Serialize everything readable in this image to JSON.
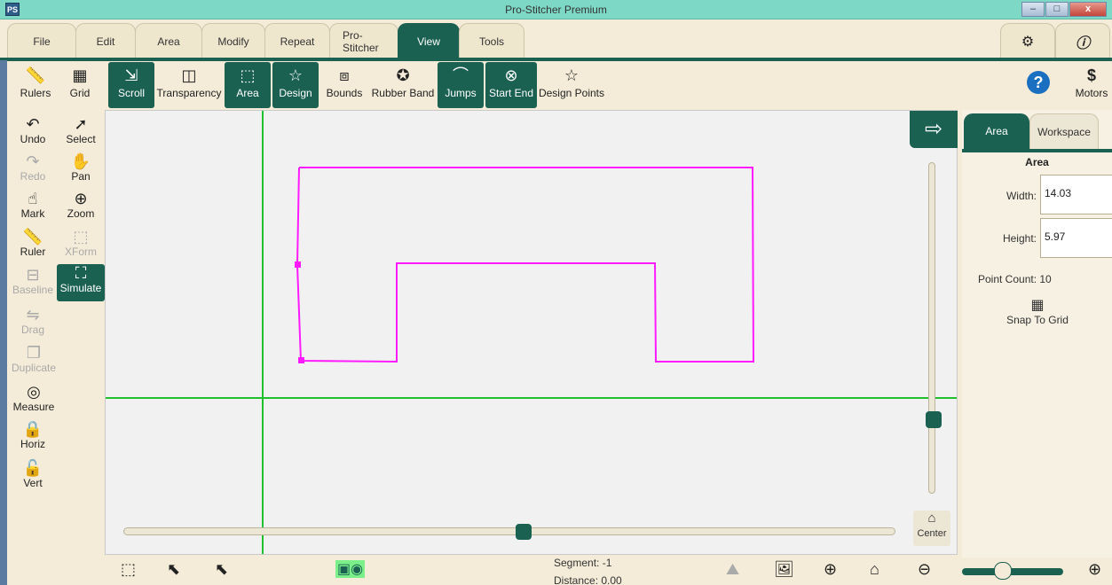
{
  "window": {
    "title": "Pro-Stitcher Premium",
    "app_icon": "PS",
    "controls": [
      "–",
      "□",
      "x"
    ]
  },
  "menu": {
    "tabs": [
      "File",
      "Edit",
      "Area",
      "Modify",
      "Repeat",
      "Pro-Stitcher",
      "View",
      "Tools"
    ],
    "active": "View",
    "right_icons": [
      "settings-gear-icon",
      "info-icon"
    ]
  },
  "toolbar": {
    "rulers": "Rulers",
    "grid": "Grid",
    "scroll": "Scroll",
    "transparency": "Transparency",
    "area": "Area",
    "design": "Design",
    "bounds": "Bounds",
    "rubber_band": "Rubber Band",
    "jumps": "Jumps",
    "start_end": "Start End",
    "design_points": "Design Points",
    "motors": "Motors"
  },
  "left_tools": {
    "undo": "Undo",
    "select": "Select",
    "redo": "Redo",
    "pan": "Pan",
    "mark": "Mark",
    "zoom": "Zoom",
    "ruler": "Ruler",
    "xform": "XForm",
    "baseline": "Baseline",
    "simulate": "Simulate",
    "drag": "Drag",
    "duplicate": "Duplicate",
    "measure": "Measure",
    "horiz": "Horiz",
    "vert": "Vert"
  },
  "canvas": {
    "center_label": "Center",
    "design_color": "#ff1aff",
    "grid_color": "#1fbf2e",
    "scroll_position": 0.5
  },
  "right_panel": {
    "tabs": [
      "Area",
      "Workspace"
    ],
    "active_tab": "Area",
    "title": "Area",
    "width_label": "Width:",
    "width_value": "14.03",
    "height_label": "Height:",
    "height_value": "5.97",
    "point_count": "Point Count:  10",
    "snap_label": "Snap To Grid"
  },
  "status": {
    "segment": "Segment: -1",
    "distance": "Distance: 0.00"
  },
  "colors": {
    "accent": "#1b6152",
    "titlebar": "#7dd8c6",
    "background": "#f4ecd8"
  }
}
